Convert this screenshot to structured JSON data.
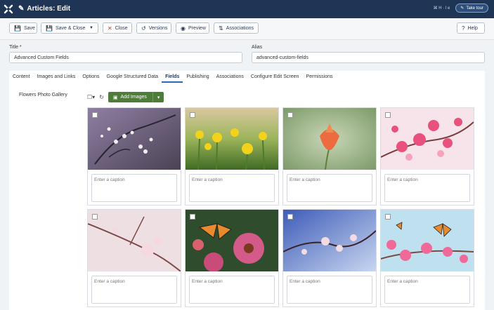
{
  "header": {
    "page_title": "Articles: Edit",
    "user_menu": "⌘ H · l e",
    "tour_label": "Take tour"
  },
  "toolbar": {
    "save": "Save",
    "save_close": "Save & Close",
    "close": "Close",
    "versions": "Versions",
    "preview": "Preview",
    "associations": "Associations",
    "help": "Help"
  },
  "form": {
    "title_label": "Title *",
    "title_value": "Advanced Custom Fields",
    "alias_label": "Alias",
    "alias_value": "advanced-custom-fields"
  },
  "tabs": [
    "Content",
    "Images and Links",
    "Options",
    "Google Structured Data",
    "Fields",
    "Publishing",
    "Associations",
    "Configure Edit Screen",
    "Permissions"
  ],
  "active_tab": "Fields",
  "gallery": {
    "field_label": "Flowers Photo Gallery",
    "add_images": "Add Images",
    "caption_placeholder": "Enter a caption"
  },
  "colors": {
    "brand": "#1f3556",
    "add_button": "#4e7d3a",
    "active_tab_accent": "#2a69b8"
  }
}
